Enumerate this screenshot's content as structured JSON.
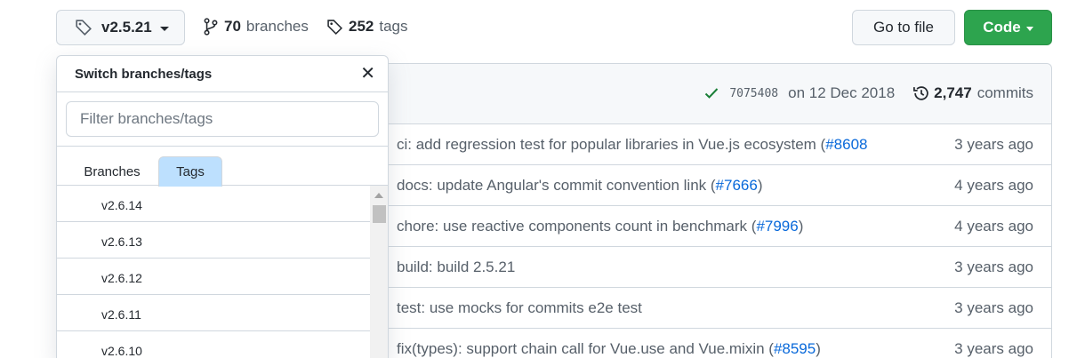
{
  "toolbar": {
    "current_ref": "v2.5.21",
    "branches_count": "70",
    "branches_label": "branches",
    "tags_count": "252",
    "tags_label": "tags",
    "go_to_file_label": "Go to file",
    "code_label": "Code"
  },
  "commit_header": {
    "sha": "7075408",
    "date": "on 12 Dec 2018",
    "commits_count": "2,747",
    "commits_label": "commits",
    "status_color": "#1a7f37"
  },
  "commits": [
    {
      "message": "ci: add regression test for popular libraries in Vue.js ecosystem (",
      "pr": "#8608",
      "suffix": "",
      "age": "3 years ago"
    },
    {
      "message": "docs: update Angular's commit convention link (",
      "pr": "#7666",
      "suffix": ")",
      "age": "4 years ago"
    },
    {
      "message": "chore: use reactive components count in benchmark (",
      "pr": "#7996",
      "suffix": ")",
      "age": "4 years ago"
    },
    {
      "message": "build: build 2.5.21",
      "pr": "",
      "suffix": "",
      "age": "3 years ago"
    },
    {
      "message": "test: use mocks for commits e2e test",
      "pr": "",
      "suffix": "",
      "age": "3 years ago"
    },
    {
      "message": "fix(types): support chain call for Vue.use and Vue.mixin (",
      "pr": "#8595",
      "suffix": ")",
      "age": "3 years ago"
    }
  ],
  "dropdown": {
    "title": "Switch branches/tags",
    "close_glyph": "✕",
    "filter_placeholder": "Filter branches/tags",
    "filter_value": "",
    "tabs": [
      {
        "label": "Branches",
        "selected": false
      },
      {
        "label": "Tags",
        "selected": true
      }
    ],
    "tag_items": [
      "v2.6.14",
      "v2.6.13",
      "v2.6.12",
      "v2.6.11",
      "v2.6.10"
    ]
  },
  "colors": {
    "primary_button": "#2da44e",
    "link": "#0969da",
    "selected_tab": "#bde0fe"
  }
}
